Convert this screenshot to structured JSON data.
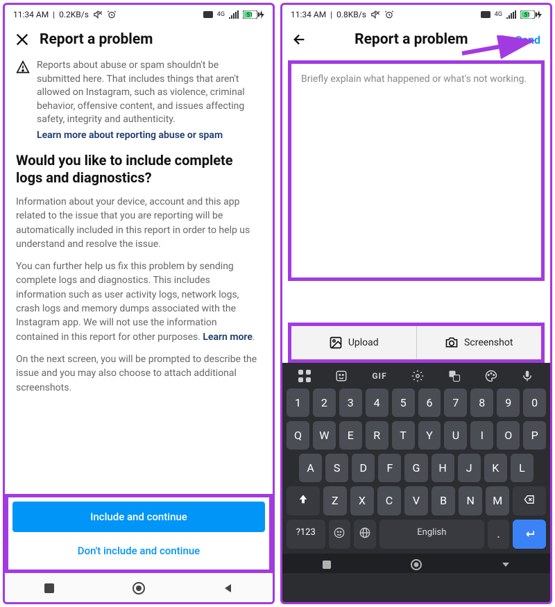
{
  "left": {
    "status": {
      "time": "11:34 AM",
      "net": "0.2KB/s"
    },
    "header": {
      "title": "Report a problem"
    },
    "info": {
      "text": "Reports about abuse or spam shouldn't be submitted here. That includes things that aren't allowed on Instagram, such as violence, criminal behavior, offensive content, and issues affecting safety, integrity and authenticity.",
      "link": "Learn more about reporting abuse or spam"
    },
    "heading": "Would you like to include complete logs and diagnostics?",
    "para1": "Information about your device, account and this app related to the issue that you are reporting will be automatically included in this report in order to help us understand and resolve the issue.",
    "para2a": "You can further help us fix this problem by sending complete logs and diagnostics. This includes information such as user activity logs, network logs, crash logs and memory dumps associated with the Instagram app. We will not use the information contained in this report for other purposes. ",
    "para2_link": "Learn more",
    "para2b": ".",
    "para3": "On the next screen, you will be prompted to describe the issue and you may also choose to attach additional screenshots.",
    "buttons": {
      "primary": "Include and continue",
      "secondary": "Don't include and continue"
    }
  },
  "right": {
    "status": {
      "time": "11:34 AM",
      "net": "0.8KB/s"
    },
    "header": {
      "title": "Report a problem",
      "send": "Send"
    },
    "textarea_placeholder": "Briefly explain what happened or what's not working.",
    "actions": {
      "upload": "Upload",
      "screenshot": "Screenshot"
    },
    "keyboard": {
      "row1": [
        "1",
        "2",
        "3",
        "4",
        "5",
        "6",
        "7",
        "8",
        "9",
        "0"
      ],
      "row2": [
        "Q",
        "W",
        "E",
        "R",
        "T",
        "Y",
        "U",
        "I",
        "O",
        "P"
      ],
      "row3": [
        "A",
        "S",
        "D",
        "F",
        "G",
        "H",
        "J",
        "K",
        "L"
      ],
      "row4": [
        "Z",
        "X",
        "C",
        "V",
        "B",
        "N",
        "M"
      ],
      "sym": "?123",
      "space": "English",
      "dot": "."
    }
  },
  "status_net_label": "4G"
}
